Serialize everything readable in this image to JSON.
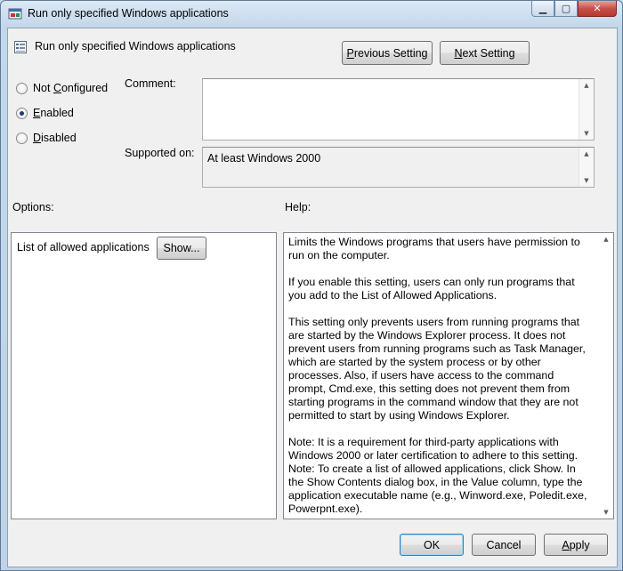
{
  "window": {
    "title": "Run only specified Windows applications",
    "caption_buttons": {
      "minimize": "▁",
      "maximize": "▢",
      "close": "✕"
    }
  },
  "header": {
    "setting_title": "Run only specified Windows applications",
    "previous_button": {
      "access_key": "P",
      "rest": "revious Setting"
    },
    "next_button": {
      "access_key": "N",
      "rest": "ext Setting"
    }
  },
  "state": {
    "options": [
      {
        "pre": "Not ",
        "key": "C",
        "post": "onfigured",
        "checked": false
      },
      {
        "pre": "",
        "key": "E",
        "post": "nabled",
        "checked": true
      },
      {
        "pre": "",
        "key": "D",
        "post": "isabled",
        "checked": false
      }
    ]
  },
  "comment": {
    "label": "Comment:",
    "value": ""
  },
  "supported": {
    "label": "Supported on:",
    "value": "At least Windows 2000"
  },
  "options_section": {
    "label": "Options:",
    "item_label": "List of allowed applications",
    "show_button": "Show..."
  },
  "help_section": {
    "label": "Help:",
    "paragraphs": [
      "Limits the Windows programs that users have permission to run on the computer.",
      "If you enable this setting, users can only run programs that you add to the List of Allowed Applications.",
      "This setting only prevents users from running programs that are started by the Windows Explorer process. It does not prevent users from running programs such as Task Manager, which are started by the system process or by other processes. Also, if users have access to the command prompt, Cmd.exe, this setting does not prevent them from starting programs in the command window that they are not permitted to start by using Windows Explorer.",
      "Note: It is a requirement for third-party applications with Windows 2000 or later certification to adhere to this setting.",
      "Note: To create a list of allowed applications, click Show. In the Show Contents dialog box, in the Value column, type the application executable name (e.g., Winword.exe, Poledit.exe, Powerpnt.exe)."
    ]
  },
  "footer": {
    "ok": "OK",
    "cancel": "Cancel",
    "apply": {
      "access_key": "A",
      "rest": "pply"
    }
  }
}
